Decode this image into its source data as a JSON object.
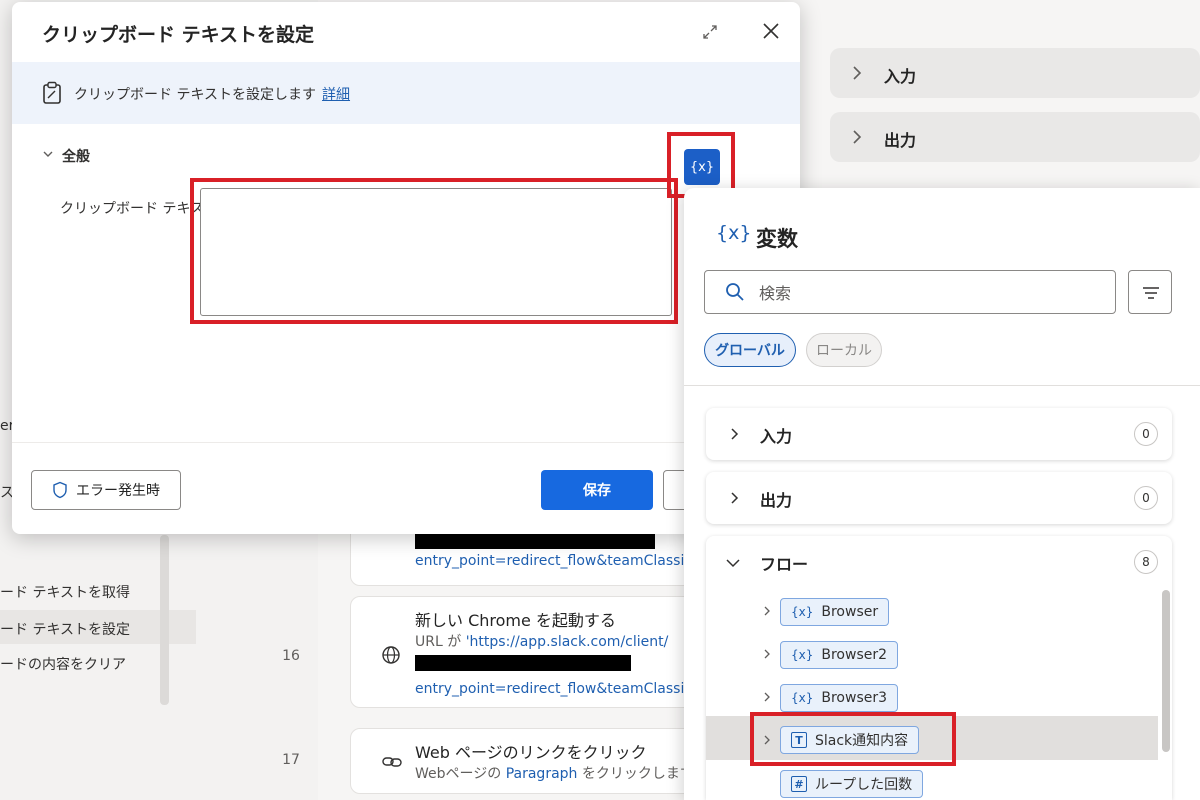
{
  "background": {
    "left_items": [
      {
        "label": "er"
      },
      {
        "label": "ス"
      },
      {
        "label": "ード テキストを取得"
      },
      {
        "label": "ード テキストを設定"
      },
      {
        "label": "ードの内容をクリア"
      }
    ],
    "steps": [
      {
        "link": "entry_point=redirect_flow&teamClassifi"
      },
      {
        "number": "16",
        "title": "新しい Chrome を起動する",
        "sub_prefix": "URL が ",
        "sub_link": "'https://app.slack.com/client/",
        "link": "entry_point=redirect_flow&teamClassifi"
      },
      {
        "number": "17",
        "title": "Web ページのリンクをクリック",
        "sub_prefix": "Webページの ",
        "sub_link": "Paragraph",
        "sub_suffix": " をクリックします"
      }
    ],
    "right_panels": [
      {
        "label": "入力"
      },
      {
        "label": "出力"
      }
    ]
  },
  "dialog": {
    "title": "クリップボード テキストを設定",
    "info_text": "クリップボード テキストを設定します",
    "info_link": "詳細",
    "section_title": "全般",
    "field_label": "クリップボード テキスト:",
    "field_value": "",
    "var_button_label": "{x}",
    "error_button_label": "エラー発生時",
    "save_label": "保存"
  },
  "variables_panel": {
    "icon": "{x}",
    "title": "変数",
    "search_placeholder": "検索",
    "tabs": {
      "global": "グローバル",
      "local": "ローカル"
    },
    "groups": {
      "input": {
        "label": "入力",
        "count": "0"
      },
      "output": {
        "label": "出力",
        "count": "0"
      },
      "flow": {
        "label": "フロー",
        "count": "8"
      }
    },
    "flow_items": [
      {
        "type_icon": "{x}",
        "label": "Browser"
      },
      {
        "type_icon": "{x}",
        "label": "Browser2"
      },
      {
        "type_icon": "{x}",
        "label": "Browser3"
      },
      {
        "type_icon": "T",
        "label": "Slack通知内容"
      },
      {
        "type_icon": "#",
        "label": "ループした回数"
      }
    ]
  },
  "colors": {
    "primary": "#1769e0",
    "accent_blue": "#1f5fb0",
    "highlight_red": "#d92027"
  }
}
